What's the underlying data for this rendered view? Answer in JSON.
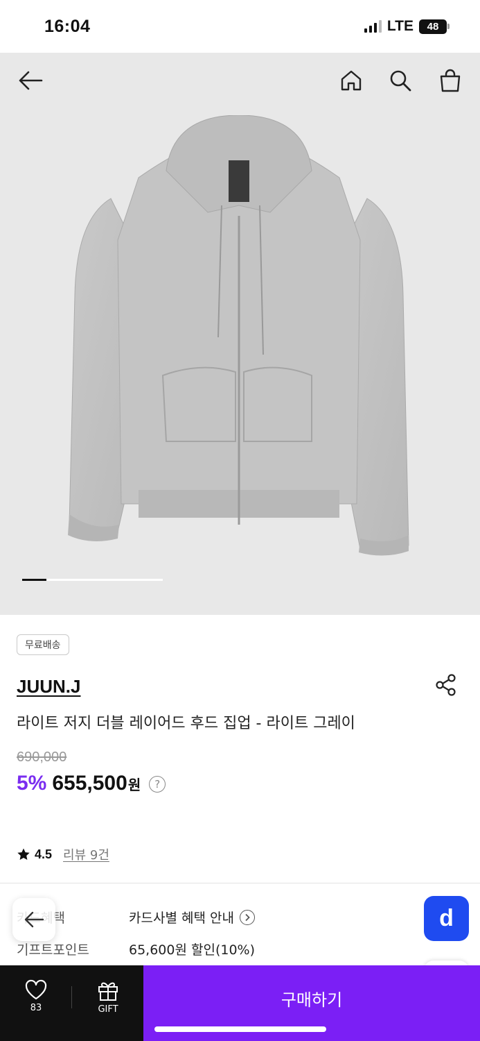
{
  "status_bar": {
    "time": "16:04",
    "network": "LTE",
    "battery": "48"
  },
  "nav": {
    "back_icon": "arrow-left-icon",
    "home_icon": "home-icon",
    "search_icon": "search-icon",
    "cart_icon": "shopping-bag-icon"
  },
  "gallery": {
    "current_slide_fraction": 0.17
  },
  "product": {
    "badge": "무료배송",
    "brand": "JUUN.J",
    "name": "라이트 저지 더블 레이어드 후드 집업 - 라이트 그레이",
    "original_price": "690,000",
    "discount": "5%",
    "price": "655,500",
    "currency": "원",
    "help": "?",
    "rating": "4.5",
    "review_link": "리뷰 9건"
  },
  "benefits": [
    {
      "label": "카드혜택",
      "value": "카드사별 혜택 안내"
    },
    {
      "label": "기프트포인트",
      "value": "65,600원 할인(10%)"
    }
  ],
  "floating": {
    "d_button": "d"
  },
  "bottom_bar": {
    "like_count": "83",
    "gift_label": "GIFT",
    "buy_label": "구매하기"
  },
  "colors": {
    "accent": "#7b1ff5",
    "discount": "#7a2df0",
    "d_button": "#1f4bf0"
  }
}
